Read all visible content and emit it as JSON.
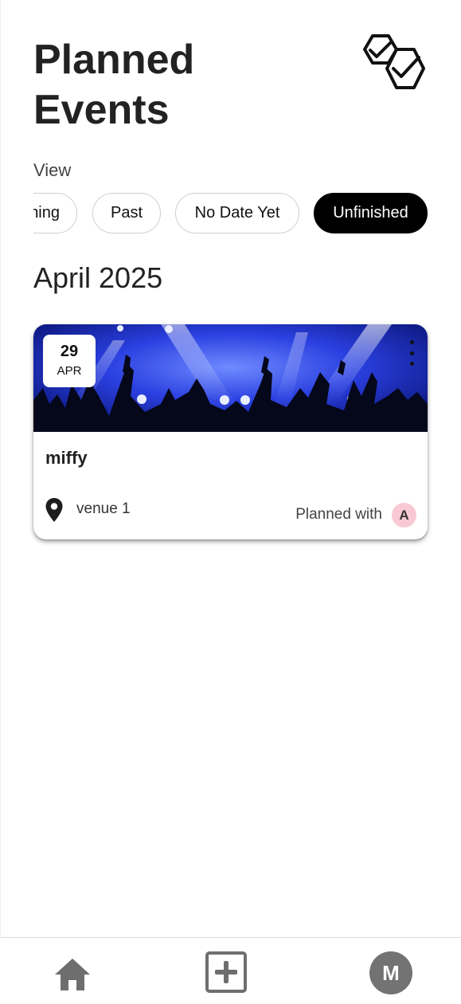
{
  "header": {
    "title_line1": "Planned",
    "title_line2": "Events",
    "logo_icon": "hexagon-checkmarks-logo"
  },
  "filters": {
    "label": "View",
    "chips": [
      {
        "label": "Upcoming",
        "visible_text": "ning",
        "active": false
      },
      {
        "label": "Past",
        "active": false
      },
      {
        "label": "No Date Yet",
        "active": false
      },
      {
        "label": "Unfinished",
        "active": true
      }
    ]
  },
  "events": {
    "month_heading": "April 2025",
    "items": [
      {
        "day": "29",
        "month": "APR",
        "name": "miffy",
        "venue": "venue 1",
        "planned_with_label": "Planned with",
        "participant_initial": "A",
        "participant_color": "#f8c9d4",
        "image": "concert-crowd-blue-lights",
        "menu_icon": "more-vertical-icon",
        "location_icon": "map-pin-icon"
      }
    ]
  },
  "bottom_nav": {
    "home_icon": "home-icon",
    "add_icon": "plus-square-icon",
    "profile_initial": "M",
    "profile_color": "#737373"
  }
}
